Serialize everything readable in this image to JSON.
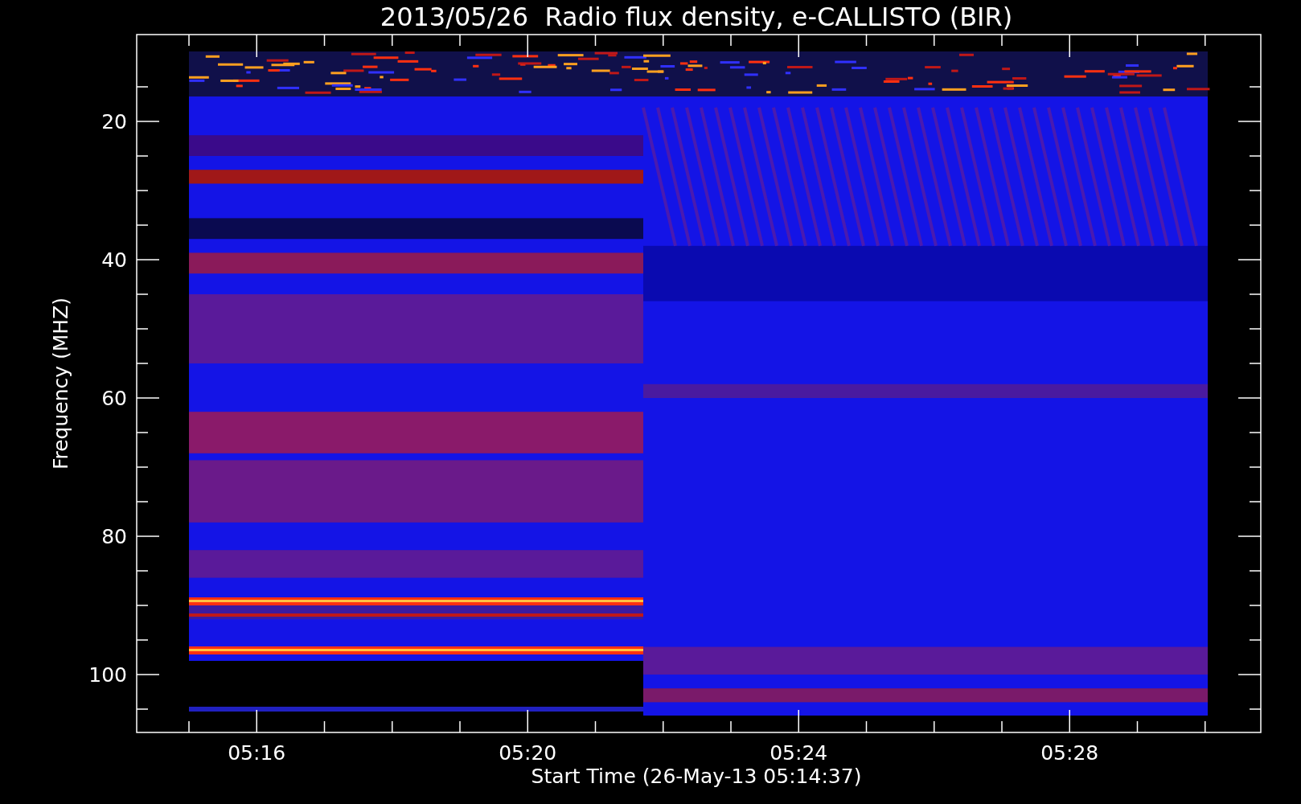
{
  "title": "2013/05/26  Radio flux density, e-CALLISTO (BIR)",
  "y_axis": {
    "label": "Frequency (MHZ)",
    "ticks": [
      "20",
      "40",
      "60",
      "80",
      "100"
    ]
  },
  "x_axis": {
    "label": "Start Time (26-May-13 05:14:37)",
    "ticks": [
      "05:16",
      "05:20",
      "05:24",
      "05:28"
    ]
  }
}
